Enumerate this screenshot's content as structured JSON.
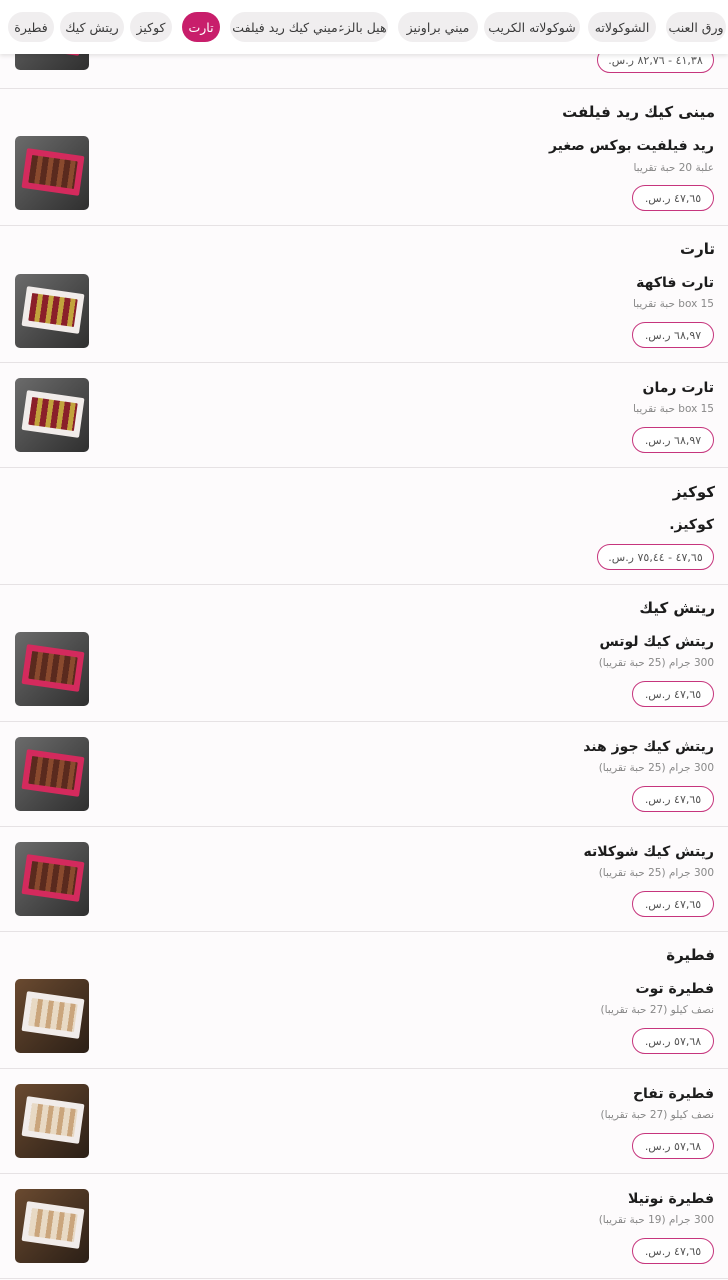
{
  "categories": [
    {
      "label": "ورق العنب",
      "active": false
    },
    {
      "label": "الشوكولاته",
      "active": false
    },
    {
      "label": "شوكولاته الكريب",
      "active": false
    },
    {
      "label": "ميني براونيز",
      "active": false
    },
    {
      "label": "هيل بالزعفران",
      "active": false
    },
    {
      "label": "ميني كيك ريد فيلفت",
      "active": false
    },
    {
      "label": "تارت",
      "active": true
    },
    {
      "label": "كوكيز",
      "active": false
    },
    {
      "label": "ريتش كيك",
      "active": false
    },
    {
      "label": "فطيرة",
      "active": false
    }
  ],
  "top_partial": {
    "price": "٤١,٣٨ - ٨٢,٧٦ ر.س."
  },
  "sections": [
    {
      "title": "مينى كيك ريد فيلفت",
      "items": [
        {
          "name": "ريد فيلفيت بوكس صغير",
          "desc": "علبة 20 حبة تقريبا",
          "price": "٤٧,٦٥ ر.س."
        }
      ]
    },
    {
      "title": "تارت",
      "items": [
        {
          "name": "تارت فاكهة",
          "desc": "15 box حبة تقريبا",
          "price": "٦٨,٩٧ ر.س."
        },
        {
          "name": "تارت رمان",
          "desc": "15 box حبة تقريبا",
          "price": "٦٨,٩٧ ر.س."
        }
      ]
    },
    {
      "title": "كوكيز",
      "items": [
        {
          "name": "كوكيز.",
          "desc": "",
          "price": "٤٧,٦٥ - ٧٥,٤٤ ر.س."
        }
      ]
    },
    {
      "title": "ريتش كيك",
      "items": [
        {
          "name": "ريتش كيك لوتس",
          "desc": "300 جرام (25 حبة تقريبا)",
          "price": "٤٧,٦٥ ر.س."
        },
        {
          "name": "ريتش كيك جوز هند",
          "desc": "300 جرام (25 حبة تقريبا)",
          "price": "٤٧,٦٥ ر.س."
        },
        {
          "name": "ريتش كيك شوكلاته",
          "desc": "300 جرام (25 حبة تقريبا)",
          "price": "٤٧,٦٥ ر.س."
        }
      ]
    },
    {
      "title": "فطيرة",
      "items": [
        {
          "name": "فطيرة توت",
          "desc": "نصف كيلو (27 حبة تقريبا)",
          "price": "٥٧,٦٨ ر.س."
        },
        {
          "name": "فطيرة تفاح",
          "desc": "نصف كيلو (27 حبة تقريبا)",
          "price": "٥٧,٦٨ ر.س."
        },
        {
          "name": "فطيرة نوتيلا",
          "desc": "300 جرام (19 حبة تقريبا)",
          "price": "٤٧,٦٥ ر.س."
        }
      ]
    }
  ],
  "colors": {
    "accent": "#c81e6b",
    "button_border": "#c6357d"
  }
}
